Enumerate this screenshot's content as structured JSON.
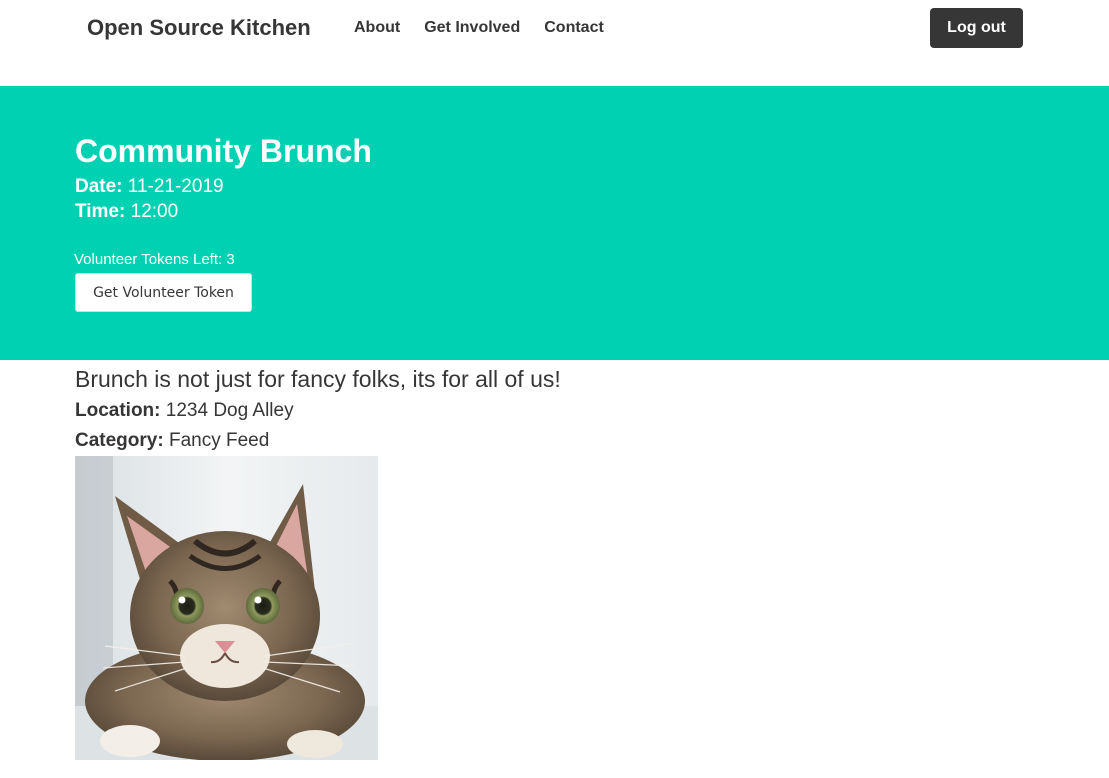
{
  "navbar": {
    "brand": "Open Source Kitchen",
    "links": [
      {
        "label": "About"
      },
      {
        "label": "Get Involved"
      },
      {
        "label": "Contact"
      }
    ],
    "logout_label": "Log out"
  },
  "event": {
    "title": "Community Brunch",
    "date_label": "Date:",
    "date": "11-21-2019",
    "time_label": "Time:",
    "time": "12:00",
    "tokens_left_text": "Volunteer Tokens Left: 3",
    "get_token_label": "Get Volunteer Token"
  },
  "details": {
    "tagline": "Brunch is not just for fancy folks, its for all of us!",
    "location_label": "Location:",
    "location": "1234 Dog Alley",
    "category_label": "Category:",
    "category": "Fancy Feed"
  },
  "colors": {
    "hero_background": "#00d1b2",
    "dark_button": "#363636",
    "text": "#363636"
  }
}
